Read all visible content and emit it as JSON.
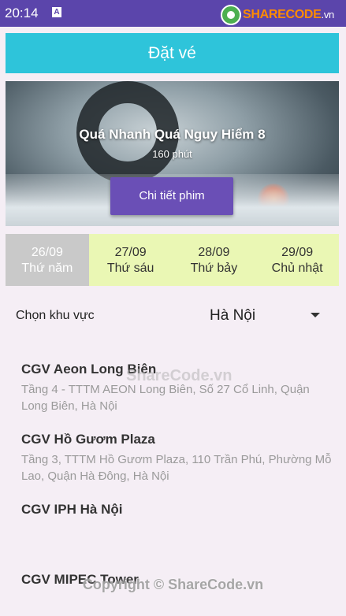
{
  "status": {
    "time": "20:14",
    "notif_glyph": "A"
  },
  "logo": {
    "brand": "SHARECODE",
    "tld": ".vn"
  },
  "appbar": {
    "title": "Đặt vé"
  },
  "movie": {
    "title": "Quá Nhanh Quá Nguy Hiểm 8",
    "duration": "160 phút",
    "details_button": "Chi tiết phim"
  },
  "dates": [
    {
      "date": "26/09",
      "weekday": "Thứ năm"
    },
    {
      "date": "27/09",
      "weekday": "Thứ sáu"
    },
    {
      "date": "28/09",
      "weekday": "Thứ bảy"
    },
    {
      "date": "29/09",
      "weekday": "Chủ nhật"
    }
  ],
  "region": {
    "label": "Chọn khu vực",
    "selected": "Hà Nội"
  },
  "cinemas": [
    {
      "name": "CGV Aeon Long Biên",
      "address": "Tầng 4  - TTTM AEON Long Biên, Số 27 Cổ Linh, Quận Long Biên, Hà Nội"
    },
    {
      "name": "CGV Hồ Gươm Plaza",
      "address": "Tầng 3, TTTM Hồ Gươm Plaza, 110 Trần Phú, Phường Mỗ Lao, Quận Hà Đông, Hà Nội"
    },
    {
      "name": "CGV IPH Hà Nội",
      "address": ""
    },
    {
      "name": "CGV MIPEC Tower",
      "address": ""
    }
  ],
  "watermarks": {
    "center": "ShareCode.vn",
    "bottom": "Copyright © ShareCode.vn"
  },
  "colors": {
    "statusbar": "#5b45ab",
    "appbar": "#2ec4da",
    "button": "#6a4fb6",
    "date_bg": "#eaf7b4",
    "date_selected": "#c9c9c9"
  }
}
